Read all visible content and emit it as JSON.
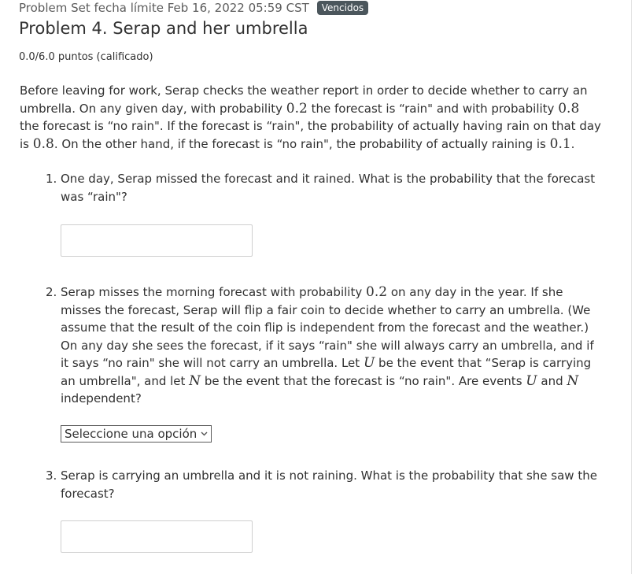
{
  "header": {
    "due_text": "Problem Set fecha límite Feb 16, 2022 05:59 CST",
    "badge": "Vencidos"
  },
  "problem": {
    "title": "Problem 4. Serap and her umbrella",
    "score": "0.0/6.0 puntos (calificado)"
  },
  "intro": {
    "s1": "Before leaving for work, Serap checks the weather report in order to decide whether to carry an umbrella. On any given day, with probability ",
    "p1": "0.2",
    "s2": " the forecast is “rain\" and with probability ",
    "p2": "0.8",
    "s3": " the forecast is “no rain\". If the forecast is “rain\", the probability of actually having rain on that day is ",
    "p3": "0.8",
    "s4": ". On the other hand, if the forecast is “no rain\", the probability of actually raining is ",
    "p4": "0.1",
    "s5": "."
  },
  "questions": [
    {
      "number": "1.",
      "text": "One day, Serap missed the forecast and it rained. What is the probability that the forecast was “rain\"?",
      "answer_value": ""
    },
    {
      "number": "2.",
      "t1": "Serap misses the morning forecast with probability ",
      "m1": "0.2",
      "t2": " on any day in the year. If she misses the forecast, Serap will flip a fair coin to decide whether to carry an umbrella. (We assume that the result of the coin flip is independent from the forecast and the weather.) On any day she sees the forecast, if it says “rain\" she will always carry an umbrella, and if it says “no rain\" she will not carry an umbrella. Let ",
      "m2": "U",
      "t3": " be the event that “Serap is carrying an umbrella\", and let ",
      "m3": "N",
      "t4": " be the event that the forecast is “no rain\". Are events ",
      "m4": "U",
      "t5": " and ",
      "m5": "N",
      "t6": " independent?",
      "select_value": "Seleccione una opción"
    },
    {
      "number": "3.",
      "text": "Serap is carrying an umbrella and it is not raining. What is the probability that she saw the forecast?",
      "answer_value": ""
    }
  ],
  "icons": {
    "select_chevron": "chevron-down-icon"
  }
}
